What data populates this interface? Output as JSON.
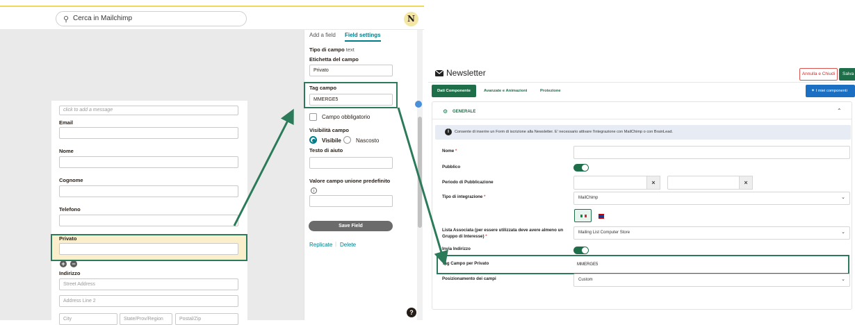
{
  "mailchimp": {
    "search_placeholder": "Cerca in Mailchimp",
    "avatar_initial": "N",
    "form": {
      "message_placeholder": "click to add a message",
      "fields": [
        {
          "label": "Email"
        },
        {
          "label": "Nome"
        },
        {
          "label": "Cognome"
        },
        {
          "label": "Telefono"
        },
        {
          "label": "Privato"
        },
        {
          "label": "Indirizzo"
        }
      ],
      "address": {
        "street": "Street Address",
        "line2": "Address Line 2",
        "city": "City",
        "state": "State/Prov/Region",
        "zip": "Postal/Zip"
      }
    },
    "panel": {
      "tab_add": "Add a field",
      "tab_settings": "Field settings",
      "tipo_label": "Tipo di campo",
      "tipo_value": "text",
      "etichetta_label": "Etichetta del campo",
      "etichetta_value": "Privato",
      "tag_label": "Tag campo",
      "tag_value": "MMERGE5",
      "obbligatorio_label": "Campo obbligatorio",
      "visibilita_label": "Visibilità campo",
      "visibile": "Visibile",
      "nascosto": "Nascosto",
      "testo_aiuto": "Testo di aiuto",
      "valore_label": "Valore campo unione predefinito",
      "save_button": "Save Field",
      "replicate": "Replicate",
      "delete": "Delete"
    },
    "help": "?"
  },
  "cms": {
    "title": "Newsletter",
    "btn_annulla": "Annulla e Chiudi",
    "btn_salva": "Salva",
    "tabs": [
      "Dati Componente",
      "Avanzate e Animazioni",
      "Protezione"
    ],
    "btn_miei": "I miei componenti",
    "section_title": "GENERALE",
    "info_text": "Consente di inserire un Form di iscrizione alla Newsletter. E' necessario attivare l'integrazione con MailChimp o con BrainLead.",
    "rows": {
      "nome": "Nome",
      "pubblico": "Pubblico",
      "periodo": "Periodo di Pubblicazione",
      "tipo_integrazione": "Tipo di integrazione",
      "tipo_value": "MailChimp",
      "lista_label": "Lista Associata (per essere utilizzata deve avere almeno un Gruppo di Interesse)",
      "lista_value": "Mailing List Computer Store",
      "invia": "Invia Indirizzo",
      "tag_label": "Tag Campo per Privato",
      "tag_value": "MMERGE5",
      "posizionamento": "Posizionamento dei campi",
      "posizionamento_value": "Custom"
    }
  }
}
